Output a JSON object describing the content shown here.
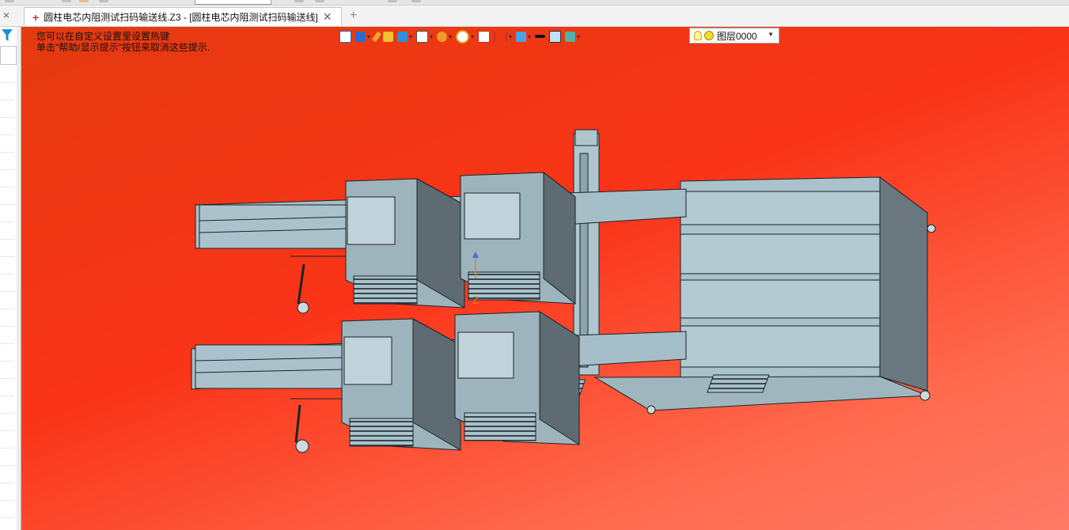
{
  "tab": {
    "title": "圆柱电芯内阻测试扫码输送线.Z3 - [圆柱电芯内阻测试扫码输送线]",
    "close_icon": "close-icon",
    "new_tab_icon": "plus-icon"
  },
  "viewport": {
    "hint_line1": "您可以在自定义设置里设置热键",
    "hint_line2": "单击\"帮助/显示提示\"按钮来取消这些提示.",
    "background_top": "#e43a10",
    "background_bottom": "#ff7a66",
    "axis_label": "Z"
  },
  "toolbar": {
    "icons": [
      "view-exit-icon",
      "render-mode-icon",
      "pencil-icon",
      "shaded-box-icon",
      "blue-cube-icon",
      "wire-cube-icon",
      "section-icon",
      "zoom-icon",
      "frame-icon",
      "dimension-icon",
      "display-icon",
      "line-color-icon",
      "fill-color-icon",
      "layer-stack-icon"
    ],
    "layer": {
      "label": "图层0000",
      "bulb_icon": "lightbulb-icon",
      "color_icon": "layer-color-dot-icon"
    }
  },
  "colors": {
    "model_fill": "#a9c2cc",
    "model_dark": "#5f6b72",
    "model_edge": "#1b2328"
  }
}
